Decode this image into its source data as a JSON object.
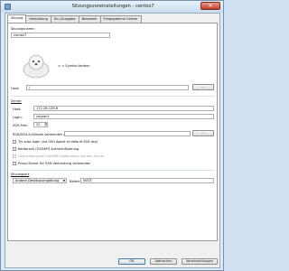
{
  "window": {
    "title": "Sitzungsvoreinstellungen - centos7",
    "close_glyph": "✕"
  },
  "tabs": [
    {
      "label": "Sitzung"
    },
    {
      "label": "Verbindung"
    },
    {
      "label": "Ein-/Ausgabe"
    },
    {
      "label": "Netzwerk"
    },
    {
      "label": "Freigegebene Ordner"
    }
  ],
  "session": {
    "name_label": "Sitzungsname:",
    "name_value": "centos7",
    "symbol_label": "< < Symbol ändern"
  },
  "host": {
    "label": "Host:",
    "value": "/",
    "browse_label": "..."
  },
  "server": {
    "section_title": "Server",
    "host_label": "Host:",
    "host_value": "172.28.128.6",
    "login_label": "Login:",
    "login_value": "vagrant",
    "port_label": "SSH-Port:",
    "port_value": "22",
    "key_label": "RSA/DSA-Schlüssel verwenden (ssh):",
    "key_value": "",
    "key_browse_label": "...",
    "checkboxes": [
      {
        "label": "Try auto login (via SSH Agent or default SSH key)",
        "disabled": false
      },
      {
        "label": "Kerberos5 (GSSAPI) Authentifizierung",
        "disabled": false
      },
      {
        "label": "Übertragung der GSSAPI Legitimation auf den Server",
        "disabled": true
      },
      {
        "label": "Proxy-Server für SSH-Verbindung verwenden",
        "disabled": false
      }
    ]
  },
  "sessiontype": {
    "section_title": "Sitzungsart",
    "type_value": "Andere Desktopumgebung",
    "command_label": "Befehl:",
    "command_value": "MATE"
  },
  "buttons": {
    "ok": "OK",
    "cancel": "Abbrechen",
    "defaults": "Voreinstellungen"
  },
  "icons": {
    "app": "window-icon",
    "seal": "seal-icon",
    "combo_arrow": "chevron-down-icon"
  }
}
